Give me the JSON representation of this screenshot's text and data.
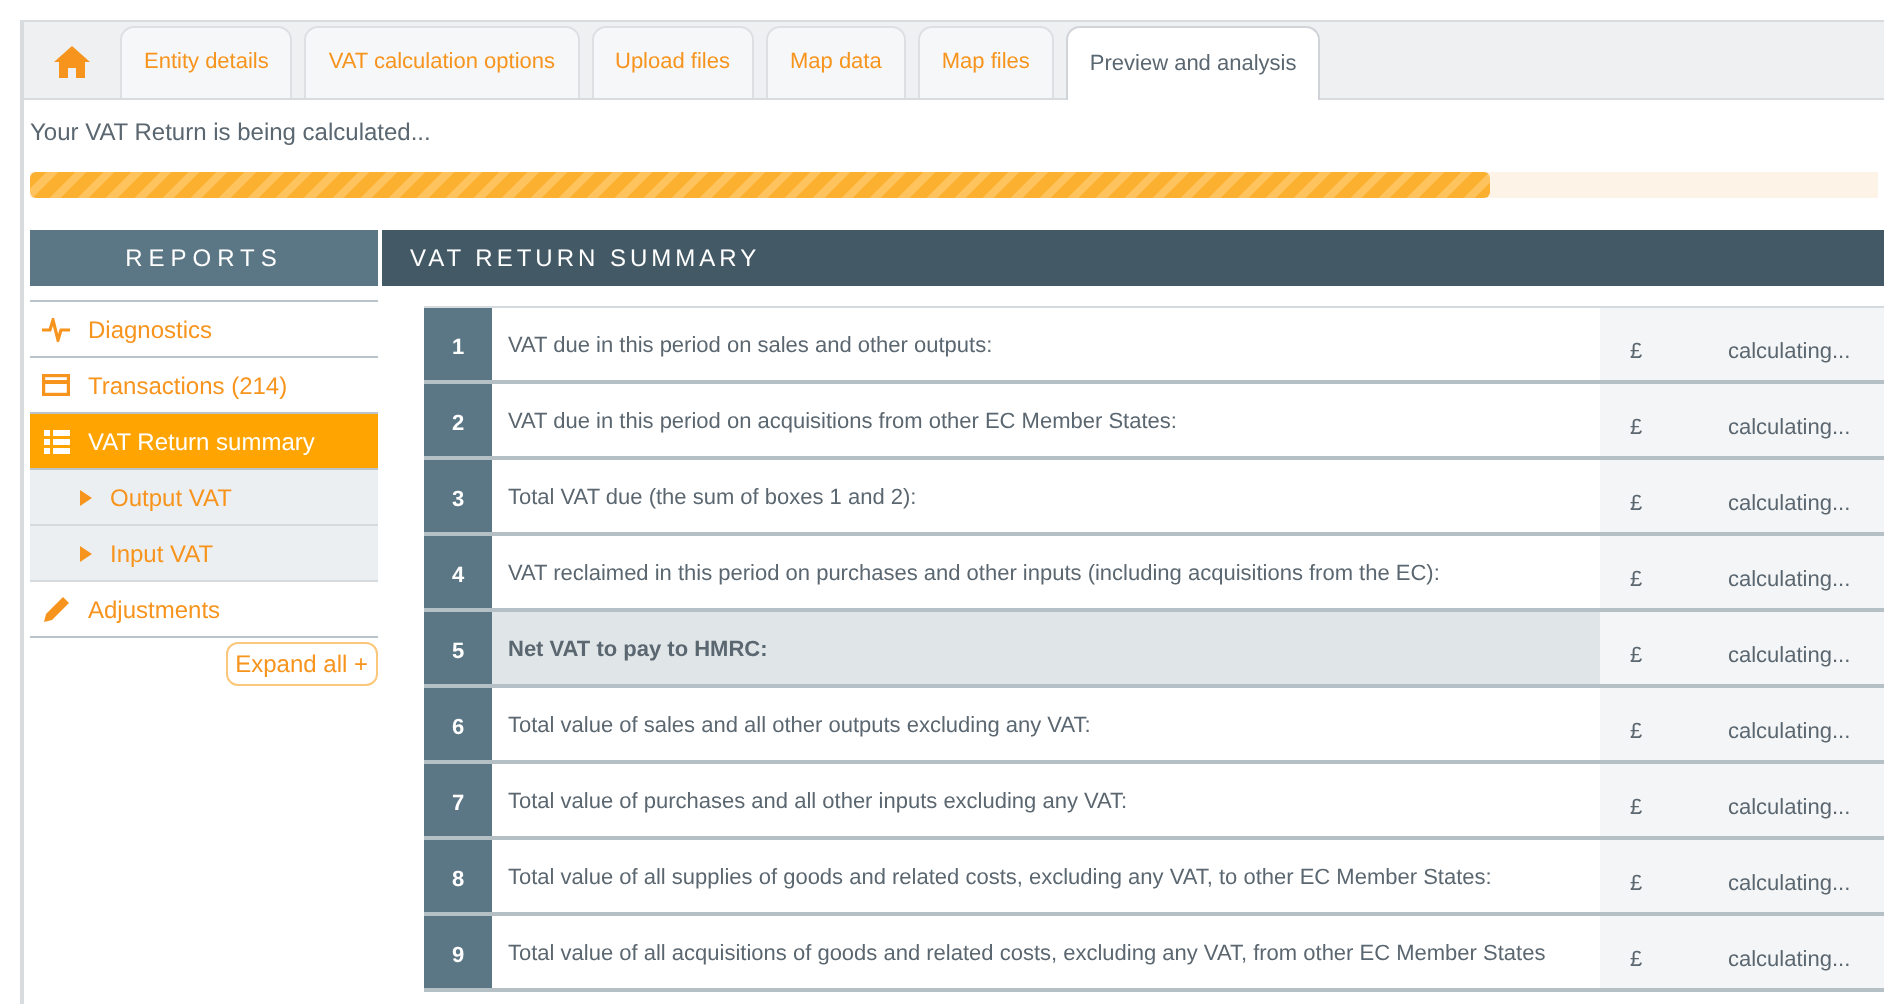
{
  "tabs": [
    {
      "kind": "home",
      "selected": false
    },
    {
      "label": "Entity details",
      "selected": false
    },
    {
      "label": "VAT calculation options",
      "selected": false
    },
    {
      "label": "Upload files",
      "selected": false
    },
    {
      "label": "Map data",
      "selected": false
    },
    {
      "label": "Map files",
      "selected": false
    },
    {
      "label": "Preview and analysis",
      "selected": true
    }
  ],
  "status_message": "Your VAT Return is being calculated...",
  "progress": {
    "level": 0.79
  },
  "sidebar": {
    "title": "REPORTS",
    "items": [
      {
        "label": "Diagnostics",
        "kind": "pulse",
        "selected": false
      },
      {
        "label": "Transactions (214)",
        "kind": "card",
        "selected": false
      },
      {
        "label": "VAT Return summary",
        "kind": "list",
        "selected": true,
        "children": [
          {
            "label": "Output VAT",
            "selected": false
          },
          {
            "label": "Input VAT",
            "selected": false
          }
        ]
      },
      {
        "label": "Adjustments",
        "kind": "pencil",
        "selected": false
      }
    ],
    "expand_button": "Expand all +"
  },
  "summary": {
    "title": "VAT RETURN SUMMARY",
    "rows": [
      {
        "number": "1",
        "label": "VAT due in this period on sales and other outputs:",
        "currency": "£",
        "value": "calculating...",
        "kind": "normal"
      },
      {
        "number": "2",
        "label": "VAT due in this period on acquisitions from other EC Member States:",
        "currency": "£",
        "value": "calculating...",
        "kind": "normal"
      },
      {
        "number": "3",
        "label": "Total VAT due (the sum of boxes 1 and 2):",
        "currency": "£",
        "value": "calculating...",
        "kind": "normal"
      },
      {
        "number": "4",
        "label": "VAT reclaimed in this period on purchases and other inputs (including acquisitions from the EC):",
        "currency": "£",
        "value": "calculating...",
        "kind": "normal"
      },
      {
        "number": "5",
        "label": "Net VAT to pay to HMRC:",
        "currency": "£",
        "value": "calculating...",
        "kind": "total"
      },
      {
        "number": "6",
        "label": "Total value of sales and all other outputs excluding any VAT:",
        "currency": "£",
        "value": "calculating...",
        "kind": "normal"
      },
      {
        "number": "7",
        "label": "Total value of purchases and all other inputs excluding any VAT:",
        "currency": "£",
        "value": "calculating...",
        "kind": "normal"
      },
      {
        "number": "8",
        "label": "Total value of all supplies of goods and related costs, excluding any VAT, to other EC Member States:",
        "currency": "£",
        "value": "calculating...",
        "kind": "normal"
      },
      {
        "number": "9",
        "label": "Total value of all acquisitions of goods and related costs, excluding any VAT, from other EC Member States",
        "currency": "£",
        "value": "calculating...",
        "kind": "normal"
      }
    ]
  }
}
